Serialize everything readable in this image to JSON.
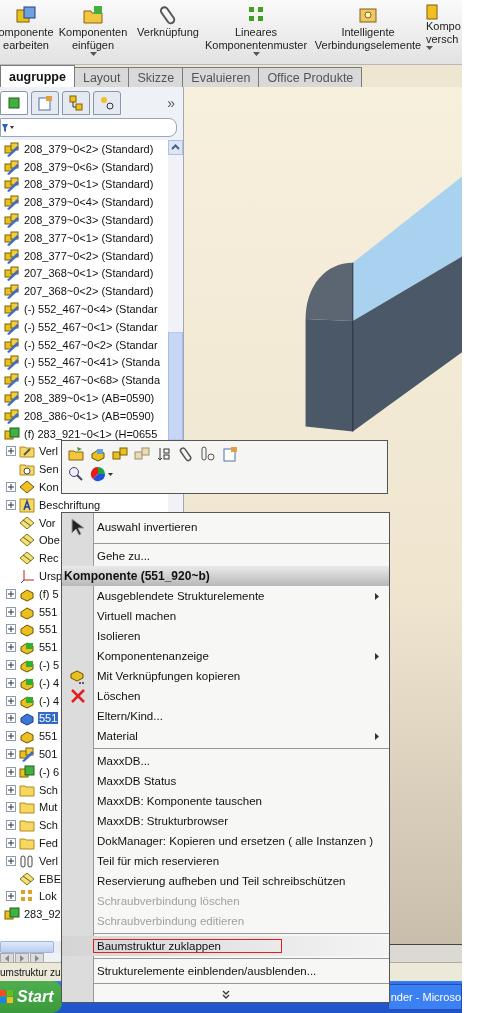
{
  "ribbon": {
    "buttons": [
      {
        "lines": [
          "omponente",
          "earbeiten"
        ],
        "kind": "edit",
        "dropdown": false
      },
      {
        "lines": [
          "Komponenten",
          "einfügen"
        ],
        "kind": "insert",
        "dropdown": true
      },
      {
        "lines": [
          "Verknüpfung"
        ],
        "kind": "mate",
        "dropdown": false
      },
      {
        "lines": [
          "Lineares",
          "Komponentenmuster"
        ],
        "kind": "pattern",
        "dropdown": true
      },
      {
        "lines": [
          "Intelligente",
          "Verbindungselemente"
        ],
        "kind": "fastener",
        "dropdown": false
      },
      {
        "lines": [
          "Kompo",
          "versch"
        ],
        "kind": "move",
        "dropdown": true
      }
    ]
  },
  "tabs": [
    {
      "label": "augruppe",
      "selected": true
    },
    {
      "label": "Layout",
      "selected": false
    },
    {
      "label": "Skizze",
      "selected": false
    },
    {
      "label": "Evaluieren",
      "selected": false
    },
    {
      "label": "Office Produkte",
      "selected": false
    }
  ],
  "panel": {
    "tabs": [
      {
        "kind": "tree",
        "selected": true
      },
      {
        "kind": "properties",
        "selected": false
      },
      {
        "kind": "config",
        "selected": false
      },
      {
        "kind": "display",
        "selected": false
      }
    ],
    "more": "»"
  },
  "tree": [
    {
      "label": "208_379~0<2> (Standard)",
      "kind": "assembly",
      "selected": false
    },
    {
      "label": "208_379~0<6> (Standard)",
      "kind": "assembly",
      "selected": false
    },
    {
      "label": "208_379~0<1> (Standard)",
      "kind": "assembly",
      "selected": false
    },
    {
      "label": "208_379~0<4> (Standard)",
      "kind": "assembly",
      "selected": false
    },
    {
      "label": "208_379~0<3> (Standard)",
      "kind": "assembly",
      "selected": false
    },
    {
      "label": "208_377~0<1> (Standard)",
      "kind": "assembly",
      "selected": false
    },
    {
      "label": "208_377~0<2> (Standard)",
      "kind": "assembly",
      "selected": false
    },
    {
      "label": "207_368~0<1> (Standard)",
      "kind": "assembly",
      "selected": false
    },
    {
      "label": "207_368~0<2> (Standard)",
      "kind": "assembly",
      "selected": false
    },
    {
      "label": "(-) 552_467~0<4> (Standar",
      "kind": "assembly",
      "selected": false
    },
    {
      "label": "(-) 552_467~0<1> (Standar",
      "kind": "assembly",
      "selected": false
    },
    {
      "label": "(-) 552_467~0<2> (Standar",
      "kind": "assembly",
      "selected": false
    },
    {
      "label": "(-) 552_467~0<41> (Standa",
      "kind": "assembly",
      "selected": false
    },
    {
      "label": "(-) 552_467~0<68> (Standa",
      "kind": "assembly",
      "selected": false
    },
    {
      "label": "208_389~0<1> (AB=0590)",
      "kind": "assembly",
      "selected": false
    },
    {
      "label": "208_386~0<1> (AB=0590)",
      "kind": "assembly",
      "selected": false
    },
    {
      "label": "(f) 283_921~0<1> (H=0655",
      "kind": "assembly-green",
      "selected": false,
      "children": [
        {
          "label": "Verl",
          "kind": "mates-folder",
          "expandable": true,
          "selected": false
        },
        {
          "label": "Sen",
          "kind": "sensor-folder",
          "expandable": false,
          "selected": false
        },
        {
          "label": "Kon",
          "kind": "config",
          "expandable": true,
          "selected": false
        },
        {
          "label": "Beschriftung",
          "kind": "annotation",
          "expandable": true,
          "selected": false
        },
        {
          "label": "Vor",
          "kind": "plane",
          "expandable": false,
          "selected": false
        },
        {
          "label": "Obe",
          "kind": "plane",
          "expandable": false,
          "selected": false
        },
        {
          "label": "Rec",
          "kind": "plane",
          "expandable": false,
          "selected": false
        },
        {
          "label": "Ursp",
          "kind": "origin",
          "expandable": false,
          "selected": false
        },
        {
          "label": "(f) 5",
          "kind": "part-yellow",
          "expandable": true,
          "selected": false
        },
        {
          "label": "551",
          "kind": "part-yellow",
          "expandable": true,
          "selected": false
        },
        {
          "label": "551",
          "kind": "part-yellow",
          "expandable": true,
          "selected": false
        },
        {
          "label": "551",
          "kind": "part-green",
          "expandable": true,
          "selected": false
        },
        {
          "label": "(-) 5",
          "kind": "part-green",
          "expandable": true,
          "selected": false
        },
        {
          "label": "(-) 4",
          "kind": "part-green",
          "expandable": true,
          "selected": false
        },
        {
          "label": "(-) 4",
          "kind": "part-green",
          "expandable": true,
          "selected": false
        },
        {
          "label": "551",
          "kind": "part-blue",
          "expandable": true,
          "selected": true
        },
        {
          "label": "551",
          "kind": "part-yellow",
          "expandable": true,
          "selected": false
        },
        {
          "label": "501",
          "kind": "assembly",
          "expandable": true,
          "selected": false
        },
        {
          "label": "(-) 6",
          "kind": "assembly-green",
          "expandable": true,
          "selected": false
        },
        {
          "label": "Sch",
          "kind": "folder",
          "expandable": true,
          "selected": false
        },
        {
          "label": "Mut",
          "kind": "folder",
          "expandable": true,
          "selected": false
        },
        {
          "label": "Sch",
          "kind": "folder",
          "expandable": true,
          "selected": false
        },
        {
          "label": "Fed",
          "kind": "folder",
          "expandable": true,
          "selected": false
        },
        {
          "label": "Verl",
          "kind": "mates",
          "expandable": true,
          "selected": false
        },
        {
          "label": "EBE",
          "kind": "plane",
          "expandable": false,
          "selected": false
        },
        {
          "label": "Lok",
          "kind": "pattern",
          "expandable": true,
          "selected": false
        }
      ]
    },
    {
      "label": "283_92",
      "kind": "assembly-green",
      "selected": false
    }
  ],
  "context_menu": {
    "items": [
      {
        "kind": "pointer",
        "label": "Auswahl invertieren",
        "submenu": false,
        "disabled": false,
        "highlighted": false
      },
      {
        "kind": "separator"
      },
      {
        "kind": "item",
        "label": "Gehe zu...",
        "submenu": false,
        "disabled": false,
        "highlighted": false
      },
      {
        "kind": "header",
        "label": "Komponente (551_920~b)"
      },
      {
        "kind": "item",
        "label": "Ausgeblendete Strukturelemente",
        "submenu": true,
        "disabled": false,
        "highlighted": false
      },
      {
        "kind": "item",
        "label": "Virtuell machen",
        "submenu": false,
        "disabled": false,
        "highlighted": false
      },
      {
        "kind": "item",
        "label": "Isolieren",
        "submenu": false,
        "disabled": false,
        "highlighted": false
      },
      {
        "kind": "item",
        "label": "Komponentenanzeige",
        "submenu": true,
        "disabled": false,
        "highlighted": false
      },
      {
        "kind": "copy",
        "label": "Mit Verknüpfungen kopieren",
        "submenu": false,
        "disabled": false,
        "highlighted": false
      },
      {
        "kind": "delete",
        "label": "Löschen",
        "submenu": false,
        "disabled": false,
        "highlighted": false
      },
      {
        "kind": "item",
        "label": "Eltern/Kind...",
        "submenu": false,
        "disabled": false,
        "highlighted": false
      },
      {
        "kind": "item",
        "label": "Material",
        "submenu": true,
        "disabled": false,
        "highlighted": false
      },
      {
        "kind": "separator"
      },
      {
        "kind": "item",
        "label": "MaxxDB...",
        "submenu": false,
        "disabled": false,
        "highlighted": false
      },
      {
        "kind": "item",
        "label": "MaxxDB Status",
        "submenu": false,
        "disabled": false,
        "highlighted": false
      },
      {
        "kind": "item",
        "label": "MaxxDB: Komponente tauschen",
        "submenu": false,
        "disabled": false,
        "highlighted": false
      },
      {
        "kind": "item",
        "label": "MaxxDB: Strukturbrowser",
        "submenu": false,
        "disabled": false,
        "highlighted": false
      },
      {
        "kind": "item",
        "label": "DokManager: Kopieren und ersetzen ( alle Instanzen )",
        "submenu": false,
        "disabled": false,
        "highlighted": false
      },
      {
        "kind": "item",
        "label": "Teil für mich reservieren",
        "submenu": false,
        "disabled": false,
        "highlighted": false
      },
      {
        "kind": "item",
        "label": "Reservierung aufheben und Teil schreibschützen",
        "submenu": false,
        "disabled": false,
        "highlighted": false
      },
      {
        "kind": "item",
        "label": "Schraubverbindung löschen",
        "submenu": false,
        "disabled": true,
        "highlighted": false
      },
      {
        "kind": "item",
        "label": "Schraubverbindung editieren",
        "submenu": false,
        "disabled": true,
        "highlighted": false
      },
      {
        "kind": "separator"
      },
      {
        "kind": "item",
        "label": "Baumstruktur zuklappen",
        "submenu": false,
        "disabled": false,
        "highlighted": true
      },
      {
        "kind": "separator"
      },
      {
        "kind": "item",
        "label": "Strukturelemente einblenden/ausblenden...",
        "submenu": false,
        "disabled": false,
        "highlighted": false
      },
      {
        "kind": "separator"
      },
      {
        "kind": "more"
      }
    ]
  },
  "status_bar": {
    "text": "umstruktur zu"
  },
  "taskbar": {
    "start": "Start",
    "tasks": [
      {
        "label": "nder - Microso"
      }
    ]
  }
}
